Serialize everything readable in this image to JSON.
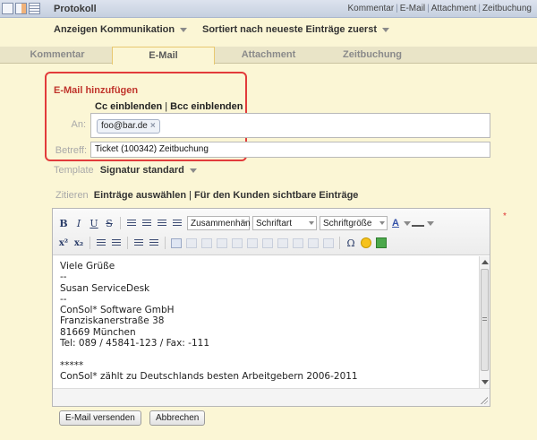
{
  "topbar": {
    "title": "Protokoll",
    "links": [
      "Kommentar",
      "E-Mail",
      "Attachment",
      "Zeitbuchung"
    ]
  },
  "subbar": {
    "filter_label": "Anzeigen Kommunikation",
    "sort_label": "Sortiert nach neueste Einträge zuerst"
  },
  "tabs": [
    {
      "label": "Kommentar",
      "active": false
    },
    {
      "label": "E-Mail",
      "active": true
    },
    {
      "label": "Attachment",
      "active": false
    },
    {
      "label": "Zeitbuchung",
      "active": false
    }
  ],
  "email_form": {
    "heading": "E-Mail hinzufügen",
    "cc_link": "Cc einblenden",
    "separator": "|",
    "bcc_link": "Bcc einblenden",
    "to_label": "An:",
    "to_recipient": "foo@bar.de",
    "remove_glyph": "×",
    "subject_label": "Betreff:",
    "subject_value": "Ticket (100342) Zeitbuchung",
    "template_label": "Template",
    "template_value": "Signatur standard",
    "quote_label": "Zitieren",
    "quote_select_link": "Einträge auswählen",
    "quote_customer_link": "Für den Kunden sichtbare Einträge",
    "required_marker": "*"
  },
  "editor": {
    "toolbar": {
      "bold": "B",
      "italic": "I",
      "underline": "U",
      "strike": "S",
      "superscript": "x²",
      "subscript": "x₂",
      "special_char": "Ω",
      "format_select": "Zusammenhän",
      "font_select": "Schriftart",
      "size_select": "Schriftgröße",
      "text_color": "A"
    },
    "lines": [
      "Viele Grüße",
      "--",
      "Susan ServiceDesk",
      "--",
      "ConSol* Software GmbH",
      "Franziskanerstraße 38",
      "81669 München",
      "Tel: 089 / 45841-123 / Fax: -111",
      "",
      "*****",
      "ConSol* zählt zu Deutschlands besten Arbeitgebern 2006-2011"
    ]
  },
  "actions": {
    "send_label": "E-Mail versenden",
    "cancel_label": "Abbrechen"
  },
  "colors": {
    "panel_bg": "#fbf6d5",
    "heading_red": "#c0352c",
    "highlight_border": "#e23b3b",
    "tab_active_border": "#e8c870"
  }
}
